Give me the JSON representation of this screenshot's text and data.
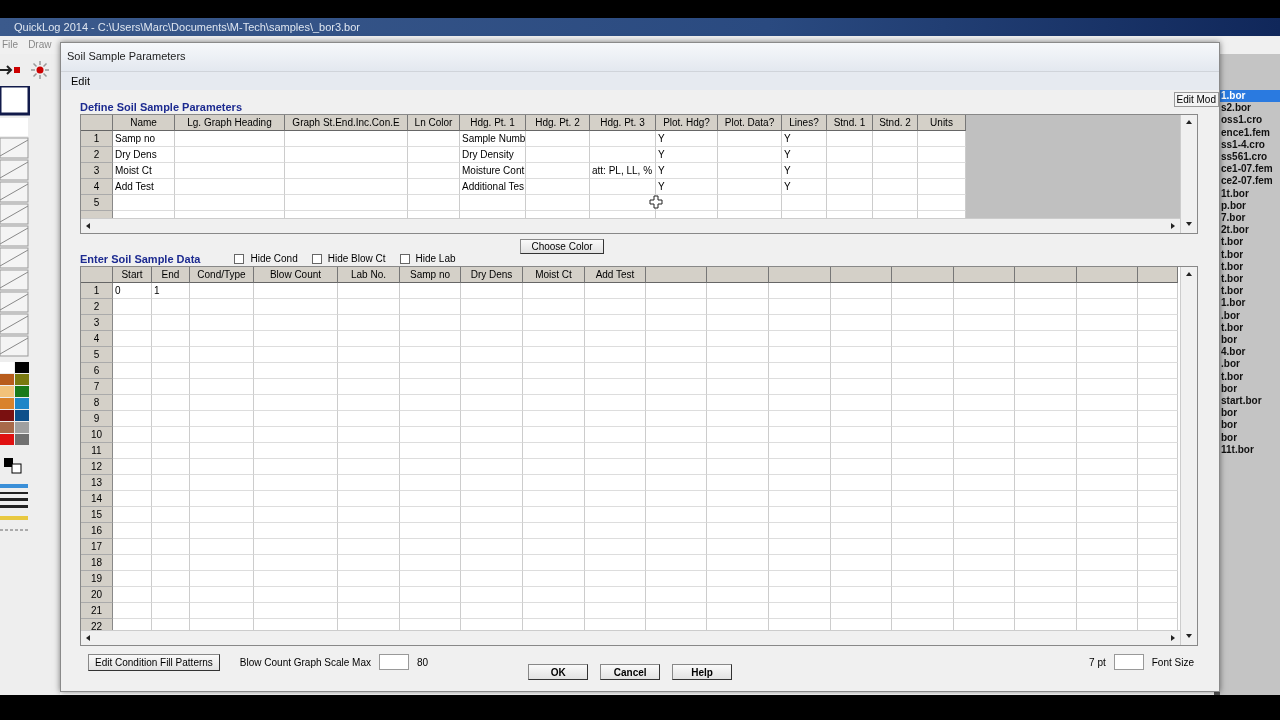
{
  "app": {
    "title": "QuickLog 2014 - C:\\Users\\Marc\\Documents\\M-Tech\\samples\\_bor3.bor",
    "menu": [
      "File",
      "Draw"
    ]
  },
  "file_list": [
    {
      "label": "1.bor",
      "selected": true
    },
    {
      "label": "s2.bor",
      "selected": false
    },
    {
      "label": "oss1.cro",
      "selected": false
    },
    {
      "label": "ence1.fem",
      "selected": false
    },
    {
      "label": "ss1-4.cro",
      "selected": false
    },
    {
      "label": "ss561.cro",
      "selected": false
    },
    {
      "label": "ce1-07.fem",
      "selected": false
    },
    {
      "label": "ce2-07.fem",
      "selected": false
    },
    {
      "label": "1t.bor",
      "selected": false
    },
    {
      "label": "p.bor",
      "selected": false
    },
    {
      "label": "7.bor",
      "selected": false
    },
    {
      "label": "2t.bor",
      "selected": false
    },
    {
      "label": "t.bor",
      "selected": false
    },
    {
      "label": "t.bor",
      "selected": false
    },
    {
      "label": "t.bor",
      "selected": false
    },
    {
      "label": "t.bor",
      "selected": false
    },
    {
      "label": "t.bor",
      "selected": false
    },
    {
      "label": "1.bor",
      "selected": false
    },
    {
      "label": ".bor",
      "selected": false
    },
    {
      "label": "t.bor",
      "selected": false
    },
    {
      "label": "bor",
      "selected": false
    },
    {
      "label": "4.bor",
      "selected": false
    },
    {
      "label": ".bor",
      "selected": false
    },
    {
      "label": "t.bor",
      "selected": false
    },
    {
      "label": "bor",
      "selected": false
    },
    {
      "label": "start.bor",
      "selected": false
    },
    {
      "label": "bor",
      "selected": false
    },
    {
      "label": "bor",
      "selected": false
    },
    {
      "label": "bor",
      "selected": false
    },
    {
      "label": "11t.bor",
      "selected": false
    }
  ],
  "dialog": {
    "title": "Soil Sample Parameters",
    "menu": [
      "Edit"
    ],
    "params": {
      "title": "Define Soil Sample Parameters",
      "side_button": "Edit Mod",
      "columns": [
        "Name",
        "Lg. Graph Heading",
        "Graph St.End.Inc.Con.E",
        "Ln Color",
        "Hdg. Pt. 1",
        "Hdg. Pt. 2",
        "Hdg. Pt. 3",
        "Plot. Hdg?",
        "Plot. Data?",
        "Lines?",
        "Stnd. 1",
        "Stnd. 2",
        "Units"
      ],
      "rows": [
        {
          "number": "1",
          "name": "Samp no",
          "hdg_pt_1": "Sample Numb",
          "plot_hdg": "Y",
          "lines": "Y"
        },
        {
          "number": "2",
          "name": "Dry Dens",
          "hdg_pt_1": "Dry Density",
          "plot_hdg": "Y",
          "lines": "Y"
        },
        {
          "number": "3",
          "name": "Moist Ct",
          "hdg_pt_1": "Moisture Cont",
          "hdg_pt_3": "att: PL, LL, %",
          "plot_hdg": "Y",
          "lines": "Y"
        },
        {
          "number": "4",
          "name": "Add Test",
          "hdg_pt_1": "Additional Tes",
          "plot_hdg": "Y",
          "lines": "Y"
        },
        {
          "number": "5"
        }
      ]
    },
    "data": {
      "title": "Enter Soil Sample Data",
      "toggles": [
        {
          "label": "Hide Cond",
          "checked": false
        },
        {
          "label": "Hide Blow Ct",
          "checked": false
        },
        {
          "label": "Hide Lab",
          "checked": false
        }
      ],
      "color_button": "Choose Color",
      "columns": [
        "Start",
        "End",
        "Cond/Type",
        "Blow Count",
        "Lab No.",
        "Samp no",
        "Dry Dens",
        "Moist Ct",
        "Add Test"
      ],
      "rows": [
        {
          "number": "1",
          "start": "0",
          "end": "1"
        },
        {
          "number": "2"
        },
        {
          "number": "3"
        },
        {
          "number": "4"
        },
        {
          "number": "5"
        },
        {
          "number": "6"
        },
        {
          "number": "7"
        },
        {
          "number": "8"
        },
        {
          "number": "9"
        },
        {
          "number": "10"
        },
        {
          "number": "11"
        },
        {
          "number": "12"
        },
        {
          "number": "13"
        },
        {
          "number": "14"
        },
        {
          "number": "15"
        },
        {
          "number": "16"
        },
        {
          "number": "17"
        },
        {
          "number": "18"
        },
        {
          "number": "19"
        },
        {
          "number": "20"
        },
        {
          "number": "21"
        },
        {
          "number": "22"
        }
      ]
    },
    "footer": {
      "fill_button": "Edit Condition Fill Patterns",
      "scale_label": "Blow Count Graph Scale Max",
      "scale_value": "80",
      "buttons": [
        "OK",
        "Cancel",
        "Help"
      ],
      "font_pt": "7 pt",
      "font_label": "Font Size"
    }
  }
}
